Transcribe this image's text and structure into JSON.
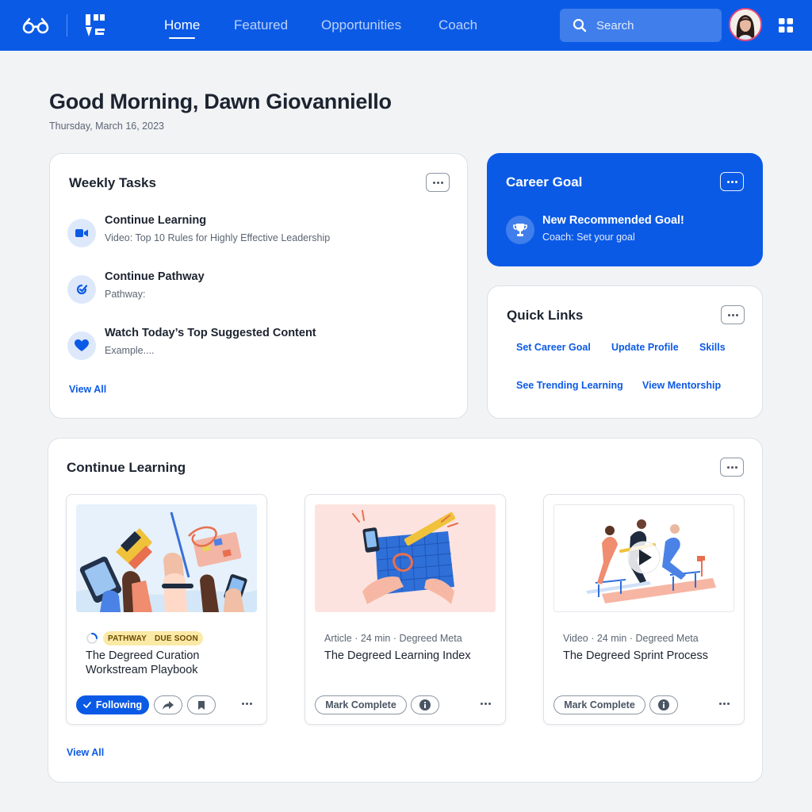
{
  "nav": {
    "links": [
      "Home",
      "Featured",
      "Opportunities",
      "Coach"
    ],
    "search_placeholder": "Search"
  },
  "greeting": {
    "title": "Good Morning, Dawn Giovanniello",
    "date": "Thursday, March 16, 2023"
  },
  "weekly_tasks": {
    "title": "Weekly Tasks",
    "items": [
      {
        "title": "Continue Learning",
        "subtitle": "Video: Top 10 Rules for Highly Effective Leadership",
        "icon": "video-icon"
      },
      {
        "title": "Continue Pathway",
        "subtitle": "Pathway:",
        "icon": "pathway-icon"
      },
      {
        "title": "Watch Today’s Top Suggested Content",
        "subtitle": "Example....",
        "icon": "heart-icon"
      }
    ],
    "view_all": "View All"
  },
  "career_goal": {
    "title": "Career Goal",
    "item_title": "New Recommended Goal!",
    "item_subtitle": "Coach: Set your goal",
    "icon": "trophy-icon"
  },
  "quick_links": {
    "title": "Quick Links",
    "links": [
      "Set Career Goal",
      "Update Profile",
      "Skills",
      "See Trending Learning",
      "View Mentorship"
    ]
  },
  "continue_learning": {
    "title": "Continue Learning",
    "view_all": "View All",
    "cards": [
      {
        "badge_type": "PATHWAY",
        "badge_status": "DUE SOON",
        "title": "The Degreed Curation Workstream Playbook",
        "primary_action": "Following"
      },
      {
        "meta": "Article · 24 min · Degreed Meta",
        "title": "The Degreed Learning Index",
        "primary_action": "Mark Complete"
      },
      {
        "meta": "Video · 24 min · Degreed Meta",
        "title": "The Degreed Sprint Process",
        "primary_action": "Mark Complete"
      }
    ]
  },
  "colors": {
    "brand": "#0b5ae6",
    "badge": "#fbe9a6",
    "background": "#f2f3f5"
  }
}
